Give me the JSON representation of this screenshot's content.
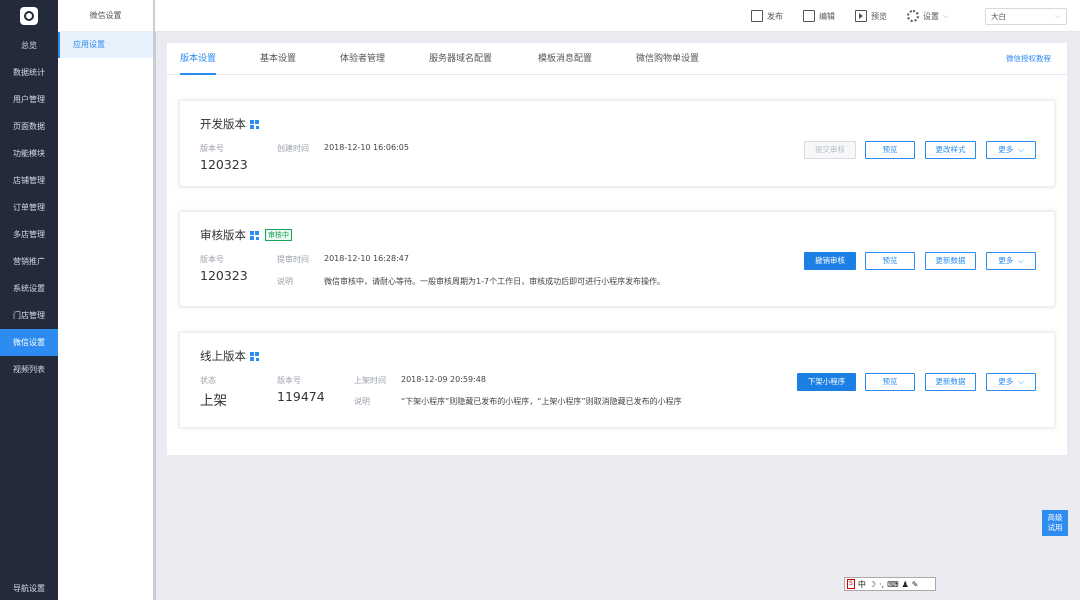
{
  "nav": {
    "items": [
      "总览",
      "数据统计",
      "用户管理",
      "页面数据",
      "功能模块",
      "店铺管理",
      "订单管理",
      "多店管理",
      "营销推广",
      "系统设置",
      "门店管理",
      "微信设置",
      "视频列表"
    ],
    "active": "微信设置",
    "bottom": "导航设置"
  },
  "subnav": {
    "title": "微信设置",
    "items": [
      "应用设置"
    ]
  },
  "topbar": {
    "publish": "发布",
    "edit": "编辑",
    "preview": "预览",
    "settings": "设置",
    "theme_value": "大白"
  },
  "tabs": {
    "items": [
      "版本设置",
      "基本设置",
      "体验者管理",
      "服务器域名配置",
      "模板消息配置",
      "微信购物单设置"
    ],
    "active": "版本设置",
    "help_link": "微信授权教程"
  },
  "cards": {
    "dev": {
      "title": "开发版本",
      "version_label": "版本号",
      "version": "120323",
      "time_label": "创建时间",
      "time": "2018-12-10 16:06:05",
      "buttons": [
        "提交审核",
        "预览",
        "更改样式",
        "更多"
      ]
    },
    "review": {
      "title": "审核版本",
      "status_badge": "审核中",
      "version_label": "版本号",
      "version": "120323",
      "time_label": "提审时间",
      "time": "2018-12-10 16:28:47",
      "desc_label": "说明",
      "desc": "微信审核中，请耐心等待。一般审核周期为1-7个工作日，审核成功后即可进行小程序发布操作。",
      "buttons": [
        "撤销审核",
        "预览",
        "更新数据",
        "更多"
      ]
    },
    "online": {
      "title": "线上版本",
      "status_label": "状态",
      "status": "上架",
      "version_label": "版本号",
      "version": "119474",
      "time_label": "上架时间",
      "time": "2018-12-09 20:59:48",
      "desc_label": "说明",
      "desc": "“下架小程序”则隐藏已发布的小程序，“上架小程序”则取消隐藏已发布的小程序",
      "buttons": [
        "下架小程序",
        "预览",
        "更新数据",
        "更多"
      ]
    }
  },
  "floating": {
    "trial_line1": "高级",
    "trial_line2": "试用"
  },
  "ime": {
    "lang": "中"
  },
  "colors": {
    "accent": "#2d8cf0",
    "nav_bg": "#232b3b",
    "review_green": "#19a15f"
  }
}
